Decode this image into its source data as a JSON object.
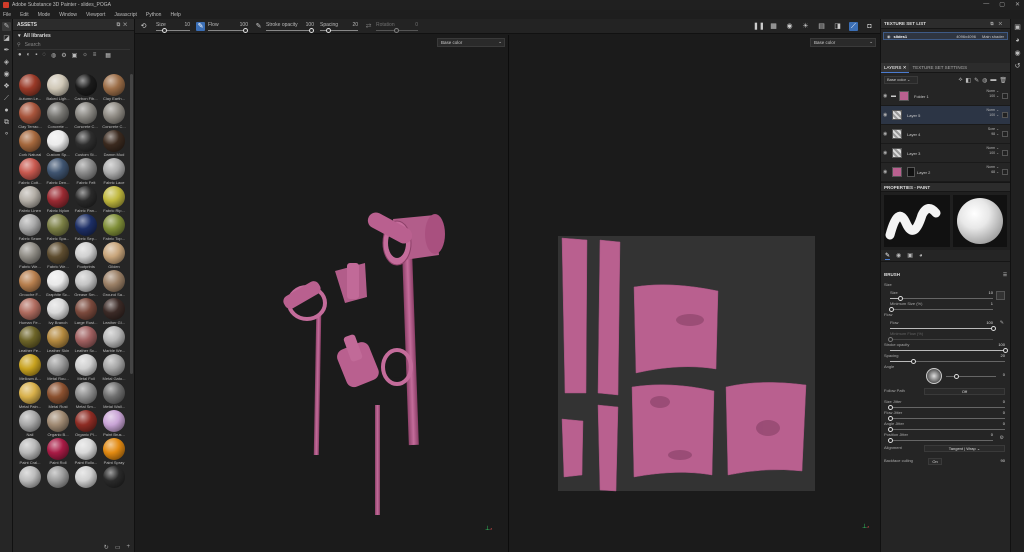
{
  "window": {
    "title": "Adobe Substance 3D Painter - slides_POGA",
    "controls": [
      "—",
      "▢",
      "✕"
    ]
  },
  "menu": [
    "File",
    "Edit",
    "Mode",
    "Window",
    "Viewport",
    "Javascript",
    "Python",
    "Help"
  ],
  "tools": [
    {
      "name": "paint-brush-icon",
      "glyph": "✎"
    },
    {
      "name": "eraser-icon",
      "glyph": "◪"
    },
    {
      "name": "projection-icon",
      "glyph": "✒"
    },
    {
      "name": "geometry-fill-icon",
      "glyph": "◈"
    },
    {
      "name": "smudge-icon",
      "glyph": "◉"
    },
    {
      "name": "clone-icon",
      "glyph": "❖"
    },
    {
      "name": "picker-icon",
      "glyph": "⟋"
    },
    {
      "name": "material-picker-icon",
      "glyph": "●"
    },
    {
      "name": "bake-icon",
      "glyph": "⧉"
    },
    {
      "name": "stencil-icon",
      "glyph": "⚬"
    }
  ],
  "assets": {
    "panel_title": "ASSETS",
    "library": "All libraries",
    "search_placeholder": "Search",
    "materials": [
      {
        "label": "Autumn Le...",
        "color": "#9a3a28"
      },
      {
        "label": "Baked Ligh...",
        "color": "#cfc7b6"
      },
      {
        "label": "Carbon Fib...",
        "color": "#1b1b1b"
      },
      {
        "label": "Clay Earth...",
        "color": "#9c6e48"
      },
      {
        "label": "Clay Terrac...",
        "color": "#a8553c"
      },
      {
        "label": "Concrete ...",
        "color": "#777672"
      },
      {
        "label": "Concrete C...",
        "color": "#8a8883"
      },
      {
        "label": "Concrete C...",
        "color": "#8f8b84"
      },
      {
        "label": "Cork Natural",
        "color": "#a5683d"
      },
      {
        "label": "Custom Sp...",
        "color": "#ebebeb"
      },
      {
        "label": "Custom St...",
        "color": "#2e2e2e"
      },
      {
        "label": "Damm Mud",
        "color": "#3b2a1f"
      },
      {
        "label": "Fabric Cott...",
        "color": "#c8594f"
      },
      {
        "label": "Fabric Den...",
        "color": "#3f5470"
      },
      {
        "label": "Fabric Felt",
        "color": "#8b8b8b"
      },
      {
        "label": "Fabric Lace",
        "color": "#adadad"
      },
      {
        "label": "Fabric Linen",
        "color": "#b3aea6"
      },
      {
        "label": "Fabric Nylon",
        "color": "#9a2a32"
      },
      {
        "label": "Fabric Pan...",
        "color": "#2a2a2a"
      },
      {
        "label": "Fabric Rip...",
        "color": "#c0b83e"
      },
      {
        "label": "Fabric Seam",
        "color": "#a9a9a9"
      },
      {
        "label": "Fabric Spa...",
        "color": "#7b7f45"
      },
      {
        "label": "Fabric Sep...",
        "color": "#1d2f66"
      },
      {
        "label": "Fabric Top...",
        "color": "#808f38"
      },
      {
        "label": "Fabric We...",
        "color": "#8f8c85"
      },
      {
        "label": "Fabric We...",
        "color": "#5e4d30"
      },
      {
        "label": "Footprints",
        "color": "#d0d0d0"
      },
      {
        "label": "Gilden",
        "color": "#c8a57b"
      },
      {
        "label": "Grouche F...",
        "color": "#b77f4e"
      },
      {
        "label": "Graphite Sc...",
        "color": "#e9e9e9"
      },
      {
        "label": "Grease Sm...",
        "color": "#c4c4c4"
      },
      {
        "label": "Ground Sa...",
        "color": "#9b8066"
      },
      {
        "label": "Human Fe...",
        "color": "#b06c5f"
      },
      {
        "label": "Ivy Branch",
        "color": "#d9d9d9"
      },
      {
        "label": "Large Rust...",
        "color": "#7b4a3d"
      },
      {
        "label": "Leather Gl...",
        "color": "#3b2a26"
      },
      {
        "label": "Leather Fe...",
        "color": "#6d6428"
      },
      {
        "label": "Leather Skin",
        "color": "#b4893f"
      },
      {
        "label": "Leather Sc...",
        "color": "#a06060"
      },
      {
        "label": "Marble We...",
        "color": "#b8b8b8"
      },
      {
        "label": "Mellown A...",
        "color": "#c9a320"
      },
      {
        "label": "Metal Rou...",
        "color": "#9a9a9a"
      },
      {
        "label": "Metal Foil",
        "color": "#cfcfcf"
      },
      {
        "label": "Metal Gato...",
        "color": "#a5a5a5"
      },
      {
        "label": "Metal Pain...",
        "color": "#d8b04a"
      },
      {
        "label": "Metal Rust",
        "color": "#8b5130"
      },
      {
        "label": "Metal Sm...",
        "color": "#8e8e8e"
      },
      {
        "label": "Metal Wall...",
        "color": "#6f6f6f"
      },
      {
        "label": "Nail",
        "color": "#a8a8a8"
      },
      {
        "label": "Organic B...",
        "color": "#a08a73"
      },
      {
        "label": "Organic Pl...",
        "color": "#8e2c24"
      },
      {
        "label": "Paint Brus...",
        "color": "#c9a4d6"
      },
      {
        "label": "Paint Cral...",
        "color": "#b9b9b9"
      },
      {
        "label": "Paint Roll",
        "color": "#a81b45"
      },
      {
        "label": "Paint Rollo...",
        "color": "#d8d8d8"
      },
      {
        "label": "Paint Spray",
        "color": "#e28a12"
      },
      {
        "label": "",
        "color": "#bbbbbb"
      },
      {
        "label": "",
        "color": "#9d9d9d"
      },
      {
        "label": "",
        "color": "#d0d0d0"
      },
      {
        "label": "",
        "color": "#2a2a2a"
      }
    ]
  },
  "toolbar": {
    "size_label": "Size",
    "size_value": "10",
    "flow_label": "Flow",
    "flow_value": "100",
    "stroke_opacity_label": "Stroke opacity",
    "stroke_opacity_value": "100",
    "spacing_label": "Spacing",
    "spacing_value": "20",
    "rotation_label": "Rotation",
    "rotation_value": "0"
  },
  "viewports": {
    "left_channel": "Base color",
    "right_channel": "Base color"
  },
  "texture_set_list": {
    "title": "TEXTURE SET LIST",
    "row": {
      "name": "slides1",
      "resolution": "4096x4096",
      "shader": "Main shader"
    }
  },
  "layers": {
    "tab_layers": "LAYERS",
    "tab_settings": "TEXTURE SET SETTINGS",
    "channel": "Base color",
    "items": [
      {
        "name": "Folder 1",
        "blend": "Norm",
        "opacity": "100",
        "type": "folder"
      },
      {
        "name": "Layer 5",
        "blend": "Norm",
        "opacity": "100",
        "type": "paint"
      },
      {
        "name": "Layer 4",
        "blend": "Scre",
        "opacity": "98",
        "type": "paint"
      },
      {
        "name": "Layer 3",
        "blend": "Norm",
        "opacity": "100",
        "type": "paint"
      },
      {
        "name": "Layer 2",
        "blend": "Norm",
        "opacity": "68",
        "type": "fill"
      }
    ]
  },
  "properties": {
    "title": "PROPERTIES - PAINT",
    "brush_title": "BRUSH",
    "size_group": "Size",
    "size": {
      "label": "Size",
      "value": "10",
      "level": 0.1
    },
    "min_size": {
      "label": "Minimum Size (%)",
      "value": "1",
      "level": 0.01
    },
    "flow_group": "Flow",
    "flow": {
      "label": "Flow",
      "value": "100",
      "level": 1.0
    },
    "min_flow": {
      "label": "Minimum Flow (%)",
      "value": "",
      "level": 0.0
    },
    "stroke_opacity": {
      "label": "Stroke opacity",
      "value": "100",
      "level": 1.0
    },
    "spacing": {
      "label": "Spacing",
      "value": "20",
      "level": 0.2
    },
    "angle": {
      "label": "Angle",
      "value": "0"
    },
    "follow_path": {
      "label": "Follow Path",
      "value": "Off"
    },
    "size_jitter": {
      "label": "Size Jitter",
      "value": "0",
      "level": 0.0
    },
    "flow_jitter": {
      "label": "Flow Jitter",
      "value": "0",
      "level": 0.0
    },
    "angle_jitter": {
      "label": "Angle Jitter",
      "value": "0",
      "level": 0.0
    },
    "position_jitter": {
      "label": "Position Jitter",
      "value": "0",
      "level": 0.0
    },
    "alignment": {
      "label": "Alignment",
      "value": "Tangent | Wrap"
    },
    "backface": {
      "label": "Backface culling",
      "value": "On",
      "value2": "90"
    }
  },
  "colors": {
    "accent": "#3b6fb6",
    "mesh_pink": "#b9608f",
    "uv_bg": "#333333"
  }
}
